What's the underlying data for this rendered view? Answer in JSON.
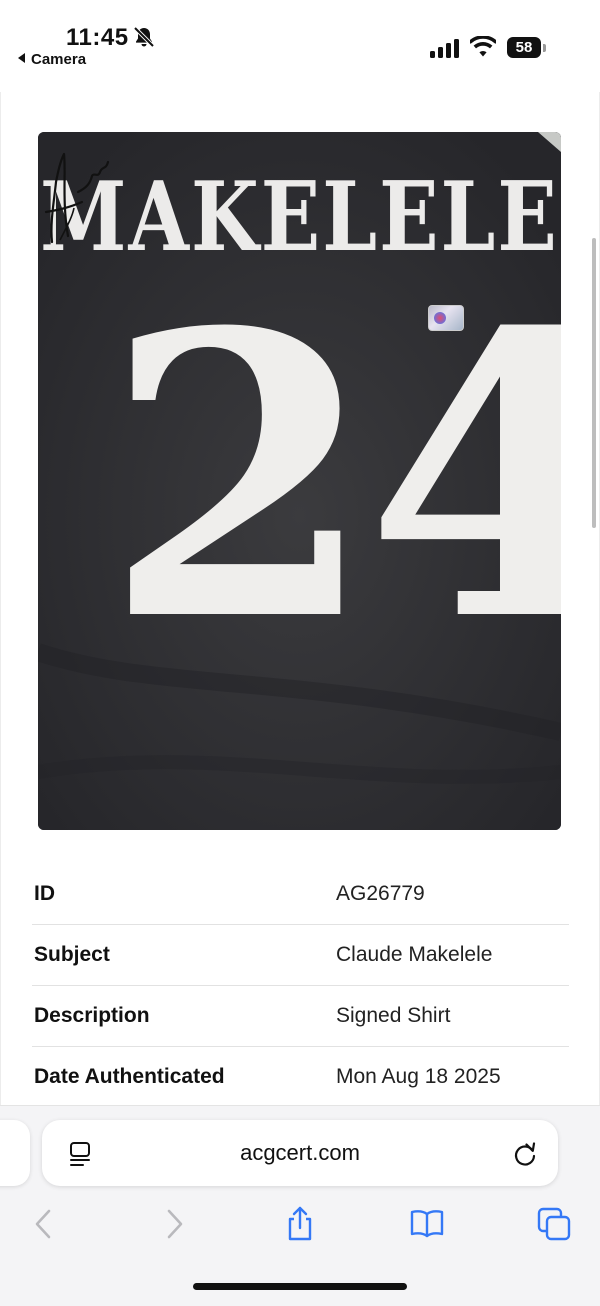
{
  "status_bar": {
    "time": "11:45",
    "back_app_label": "Camera",
    "battery_level": "58",
    "icons": [
      "bell-slash-icon",
      "cellular-signal-icon",
      "wifi-icon",
      "battery-icon"
    ]
  },
  "photo": {
    "jersey_name": "MAKELELE",
    "jersey_number": "24"
  },
  "details": {
    "rows": [
      {
        "label": "ID",
        "value": "AG26779"
      },
      {
        "label": "Subject",
        "value": "Claude Makelele"
      },
      {
        "label": "Description",
        "value": "Signed Shirt"
      },
      {
        "label": "Date Authenticated",
        "value": "Mon Aug 18 2025"
      }
    ]
  },
  "browser": {
    "url": "acgcert.com",
    "icons": [
      "reader-icon",
      "reload-icon",
      "back-icon",
      "forward-icon",
      "share-icon",
      "bookmarks-icon",
      "tabs-icon"
    ]
  },
  "colors": {
    "shirt": "#2f2f32",
    "print": "#efeeec",
    "toolbar_blue": "#3478f6",
    "toolbar_disabled": "#b9b9bd"
  }
}
